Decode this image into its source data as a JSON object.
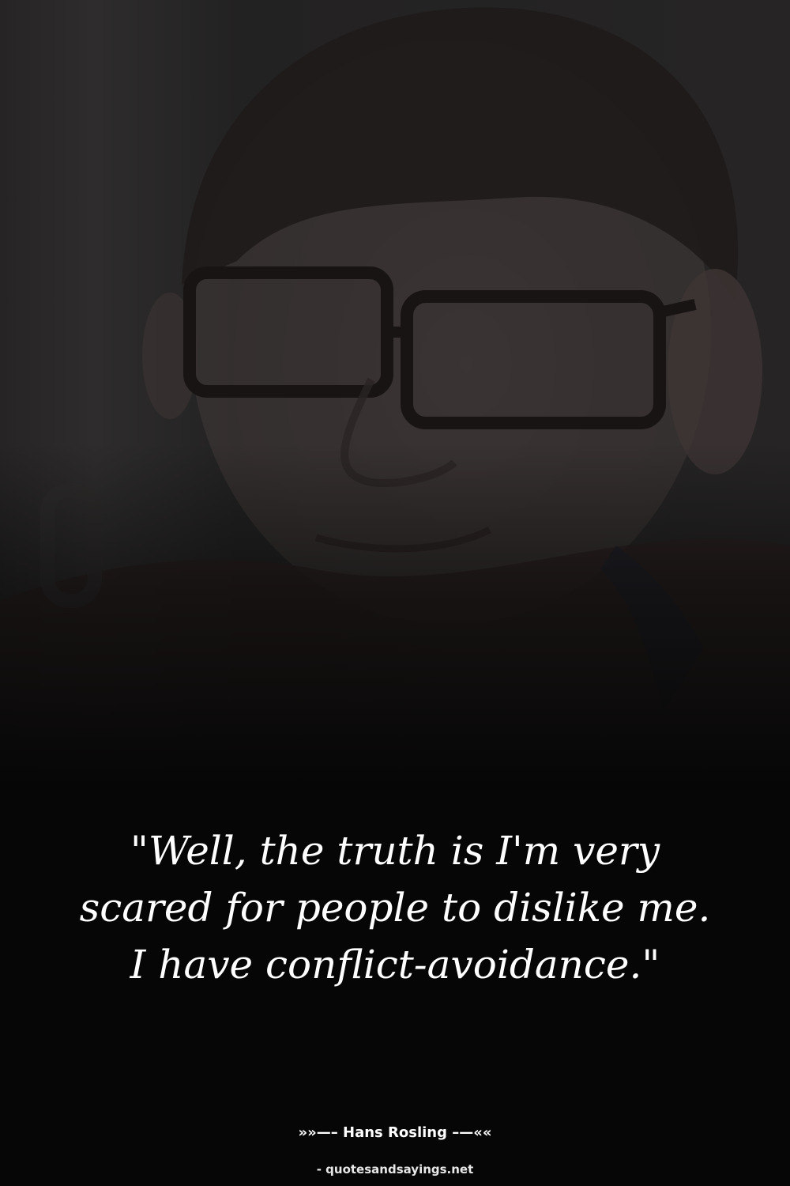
{
  "photo": {
    "subject": "portrait-photo"
  },
  "quote": {
    "text": "\"Well, the truth is I'm very scared for people to dislike me. I have conflict-avoidance.\""
  },
  "attribution": {
    "author_line": "»»—– Hans Rosling –—««"
  },
  "footer": {
    "source": "- quotesandsayings.net"
  },
  "colors": {
    "background": "#060606",
    "text": "#ffffff"
  }
}
